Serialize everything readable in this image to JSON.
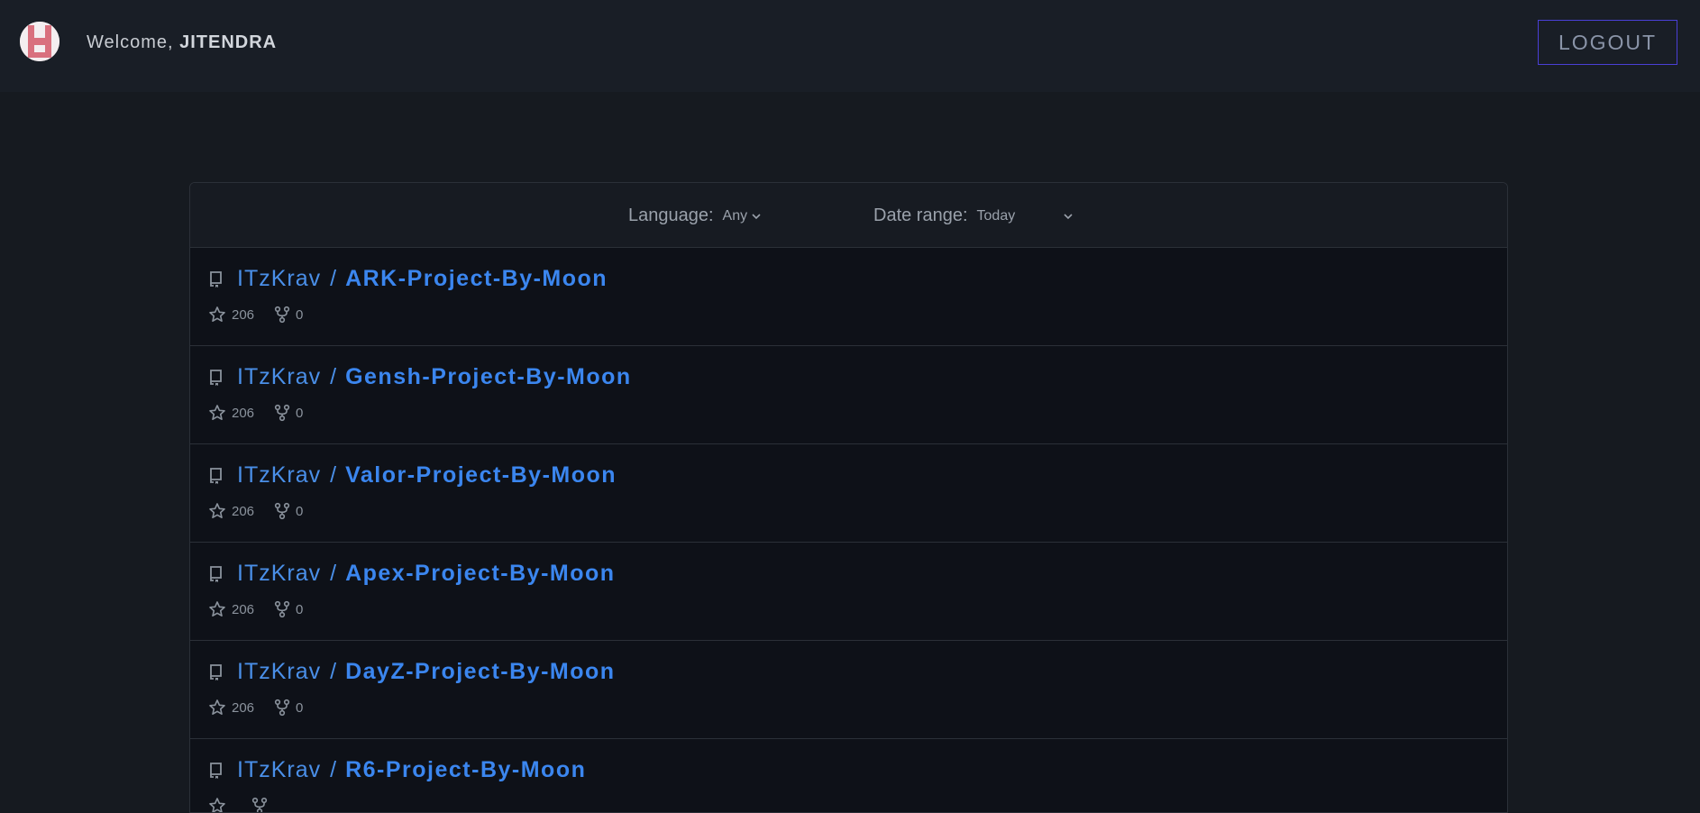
{
  "header": {
    "welcome_prefix": "Welcome, ",
    "username": "JITENDRA",
    "logout_label": "LOGOUT",
    "avatar_icon": "avatar-icon"
  },
  "filters": {
    "language_label": "Language:",
    "language_value": "Any",
    "date_label": "Date range:",
    "date_value": "Today"
  },
  "repos": [
    {
      "owner": "ITzKrav",
      "separator": "/",
      "name": "ARK-Project-By-Moon",
      "stars": "206",
      "forks": "0"
    },
    {
      "owner": "ITzKrav",
      "separator": "/",
      "name": "Gensh-Project-By-Moon",
      "stars": "206",
      "forks": "0"
    },
    {
      "owner": "ITzKrav",
      "separator": "/",
      "name": "Valor-Project-By-Moon",
      "stars": "206",
      "forks": "0"
    },
    {
      "owner": "ITzKrav",
      "separator": "/",
      "name": "Apex-Project-By-Moon",
      "stars": "206",
      "forks": "0"
    },
    {
      "owner": "ITzKrav",
      "separator": "/",
      "name": "DayZ-Project-By-Moon",
      "stars": "206",
      "forks": "0"
    },
    {
      "owner": "ITzKrav",
      "separator": "/",
      "name": "R6-Project-By-Moon",
      "stars": "",
      "forks": ""
    }
  ],
  "colors": {
    "background": "#161a20",
    "topbar": "#191e26",
    "link": "#3b86ef",
    "logout_border": "#4a3fd6"
  }
}
